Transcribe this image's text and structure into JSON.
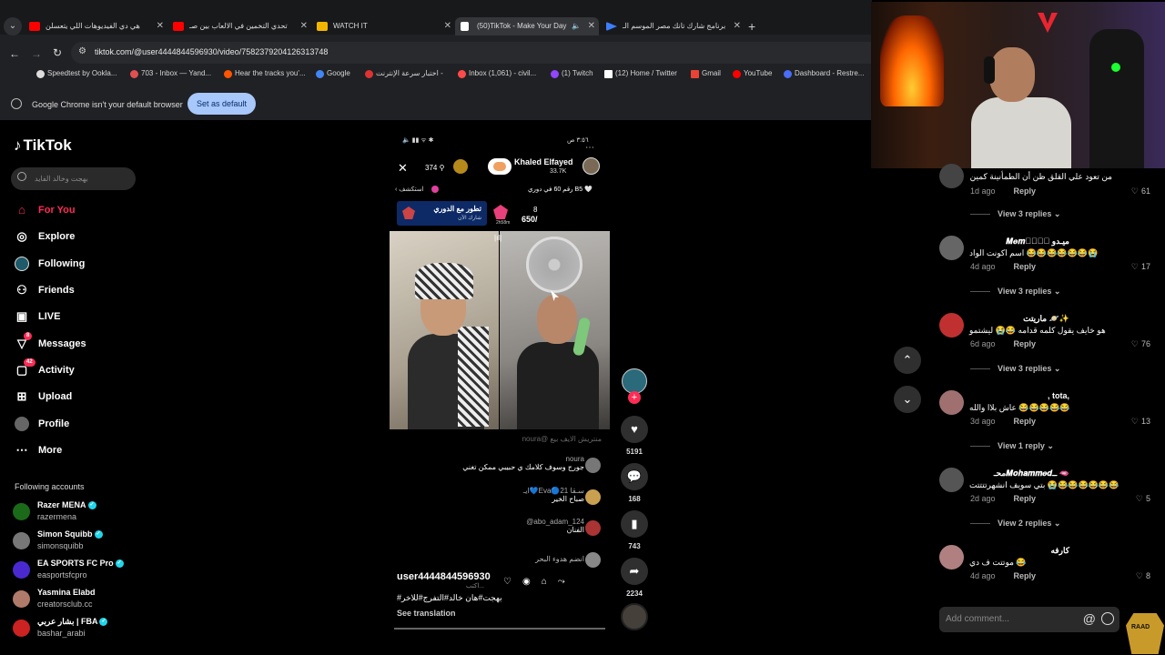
{
  "browser": {
    "tabs": [
      {
        "label": "هي دي الفيديوهات اللي يتعسلن",
        "color": "#ff0000"
      },
      {
        "label": "تحدي التخمين في الالعاب بين صـ",
        "color": "#ff0000"
      },
      {
        "label": "WATCH IT",
        "color": "#f2b600"
      },
      {
        "label": "(50)TikTok - Make Your Day",
        "color": "#ffffff",
        "active": true
      },
      {
        "label": "برنامج شارك تانك مصر الموسم الـ",
        "color": "#3d7eff"
      }
    ],
    "url": "tiktok.com/@user4444844596930/video/7582379204126313748",
    "bookmarks": [
      {
        "label": "Speedtest by Ookla...",
        "color": "#ddd"
      },
      {
        "label": "703 - Inbox — Yand...",
        "color": "#e05050"
      },
      {
        "label": "Hear the tracks you'...",
        "color": "#ff5500"
      },
      {
        "label": "Google",
        "color": "#4285f4"
      },
      {
        "label": "اختبار سرعة الإنترنت -",
        "color": "#d33"
      },
      {
        "label": "Inbox (1,061) - civil...",
        "color": "#ff4a4a"
      },
      {
        "label": "(1) Twitch",
        "color": "#9146ff"
      },
      {
        "label": "(12) Home / Twitter",
        "color": "#fff"
      },
      {
        "label": "Gmail",
        "color": "#ea4335"
      },
      {
        "label": "YouTube",
        "color": "#ff0000"
      },
      {
        "label": "Dashboard - Restre...",
        "color": "#4a6cf7"
      }
    ],
    "infobar_text": "Google Chrome isn't your default browser",
    "infobar_button": "Set as default"
  },
  "sidebar": {
    "logo": "TikTok",
    "search_placeholder": "بهجت وخالد الفايد",
    "nav": [
      {
        "label": "For You",
        "icon": "home-icon",
        "glyph": "⌂"
      },
      {
        "label": "Explore",
        "icon": "compass-icon",
        "glyph": "◎"
      },
      {
        "label": "Following",
        "icon": "following-icon",
        "glyph": "●"
      },
      {
        "label": "Friends",
        "icon": "friends-icon",
        "glyph": "👥"
      },
      {
        "label": "LIVE",
        "icon": "live-icon",
        "glyph": "▣"
      },
      {
        "label": "Messages",
        "icon": "messages-icon",
        "glyph": "▽",
        "badge": "8"
      },
      {
        "label": "Activity",
        "icon": "activity-icon",
        "glyph": "▢",
        "badge": "42"
      },
      {
        "label": "Upload",
        "icon": "upload-icon",
        "glyph": "⊞"
      },
      {
        "label": "Profile",
        "icon": "profile-icon",
        "glyph": "●"
      },
      {
        "label": "More",
        "icon": "more-icon",
        "glyph": "⋯"
      }
    ],
    "following_title": "Following accounts",
    "following": [
      {
        "name": "Razer MENA",
        "handle": "razermena",
        "verified": true,
        "color": "#1a6a1a"
      },
      {
        "name": "Simon Squibb",
        "handle": "simonsquibb",
        "verified": true,
        "color": "#777"
      },
      {
        "name": "EA SPORTS FC Pro",
        "handle": "easportsfcpro",
        "verified": true,
        "color": "#4a2ad0"
      },
      {
        "name": "Yasmina Elabd",
        "handle": "creatorsclub.cc",
        "verified": false,
        "color": "#b07a6a"
      },
      {
        "name": "بشار عربي | FBA",
        "handle": "bashar_arabi",
        "verified": true,
        "color": "#c22"
      }
    ]
  },
  "video": {
    "status_time": "٣:٥٦ ص",
    "viewers": "374",
    "host_name": "Khaled  Elfayed",
    "host_likes": "33.7K",
    "explore": "استكشف",
    "rank": "رقم 60 في دوري B5",
    "league_title": "تطور مع الدوري",
    "league_sub": "شارك الآن",
    "points_label": "2h58m",
    "score_top": "8",
    "score_bottom": "650/",
    "chat": [
      {
        "user": "noura@ منتريش الايف بيع",
        "text": "",
        "faded": true
      },
      {
        "user": "noura",
        "text": "جورج وسوف كلامك ي حبيبي ممكن تغني",
        "av": "#777"
      },
      {
        "user": "ايـ💙Eva🔵21 سـقا",
        "text": "صباح الخير",
        "av": "#c8a050"
      },
      {
        "user": "@abo_adam_124",
        "text": "الفنان",
        "av": "#a33"
      },
      {
        "user": "انضم هدوء البحر",
        "text": "",
        "av": "#888"
      }
    ],
    "username": "user4444844596930",
    "hashtags": "#بهجت#هان خالد#التفرج#للاخر",
    "typing_placeholder": "اكتب...",
    "see_translation": "See translation",
    "likes": "5191",
    "comments": "168",
    "saves": "743",
    "shares": "2234"
  },
  "comments": [
    {
      "name": "",
      "text": "من تعود علي القلق ظن أن الطمأنينة كمين",
      "time": "1d ago",
      "likes": "61",
      "replies": "View 3 replies",
      "av": "#444"
    },
    {
      "name": "𝑴𝒆𝒎𝒐ًٍِ ميـدو",
      "text": "اسم اكونت الواد 😂😂😂😂😂😂😭",
      "time": "4d ago",
      "likes": "17",
      "replies": "View 3 replies",
      "av": "#666"
    },
    {
      "name": "ماريتت 🪐✨",
      "text": "هو خايف يقول كلمه قدامه 😂😭 ليشتمو",
      "time": "6d ago",
      "likes": "76",
      "replies": "View 3 replies",
      "av": "#c03030"
    },
    {
      "name": ", tota,",
      "text": "عاش بلاا والله 😂😂😂😂😂",
      "time": "3d ago",
      "likes": "13",
      "replies": "View 1 reply",
      "av": "#a07070"
    },
    {
      "name": "محـ𝑴𝒐𝒉𝒂𝒎𝒎𝒆𝒅ــ 🫦",
      "text": "بتي سويف انشهرتتتتت 😭😂😂😂😂😂😂",
      "time": "2d ago",
      "likes": "5",
      "replies": "View 2 replies",
      "av": "#555"
    },
    {
      "name": "كارفه",
      "text": "موتتت ف دي 😂",
      "time": "4d ago",
      "likes": "8",
      "replies": "",
      "av": "#b08080"
    }
  ],
  "reply_label": "Reply",
  "add_comment_placeholder": "Add comment...",
  "raad_label": "RAAD"
}
